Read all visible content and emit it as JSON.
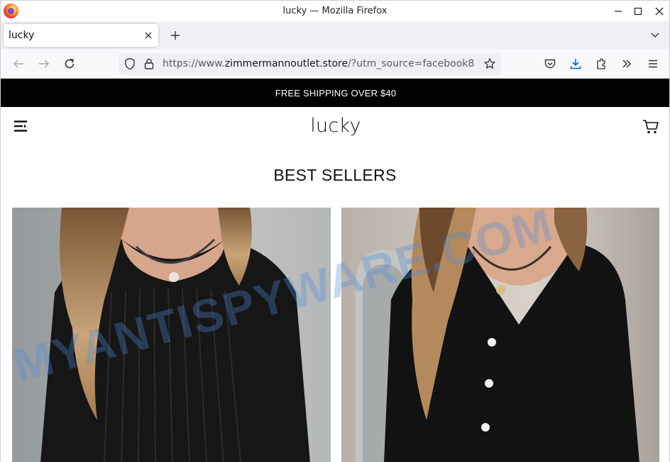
{
  "window": {
    "title": "lucky — Mozilla Firefox"
  },
  "tabs": [
    {
      "label": "lucky",
      "active": true
    }
  ],
  "urlbar": {
    "scheme": "https://www.",
    "host": "zimmermannoutlet.store",
    "path": "/?utm_source=facebook8"
  },
  "store": {
    "announcement": "FREE SHIPPING OVER $40",
    "logo": "lucky",
    "section_title": "BEST SELLERS"
  },
  "watermark": "MYANTISPYWARE.COM",
  "colors": {
    "announcement_bg": "#000000",
    "watermark": "#508cdc",
    "download_icon": "#0a64c8"
  },
  "icons": {
    "menu": "hamburger-icon",
    "cart": "shopping-cart-icon",
    "shield": "tracking-protection-icon",
    "lock": "lock-icon",
    "bookmark": "star-icon"
  }
}
